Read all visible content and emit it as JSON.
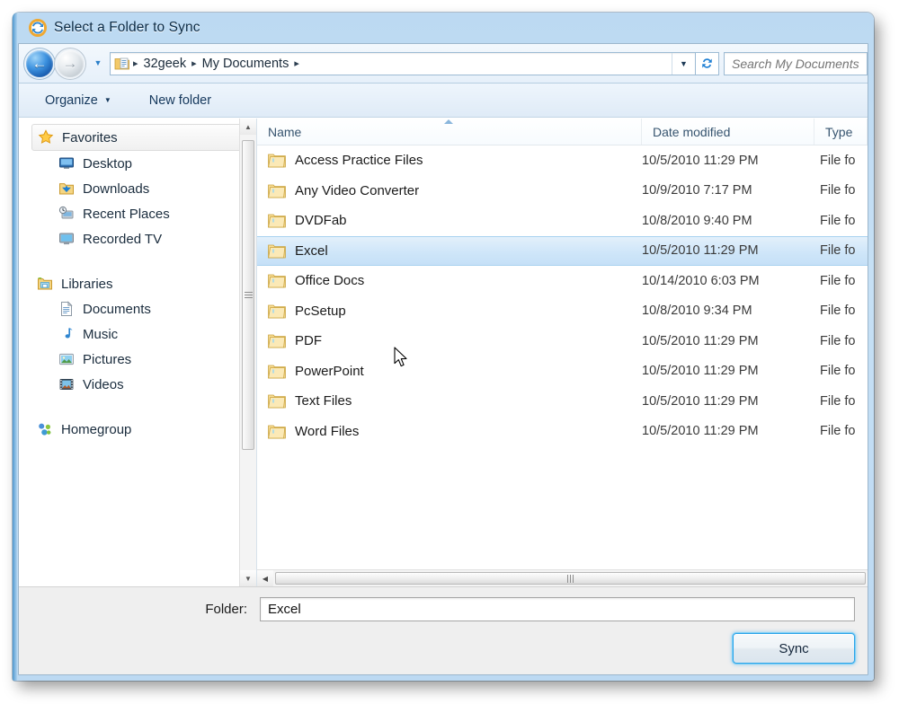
{
  "window": {
    "title": "Select a Folder to Sync",
    "title_icon": "sync-icon"
  },
  "navbar": {
    "back_icon": "back-arrow-icon",
    "forward_icon": "forward-arrow-icon",
    "recent_pages_icon": "chevron-down-icon",
    "address_icon": "folder-documents-icon",
    "breadcrumbs": [
      "32geek",
      "My Documents"
    ],
    "separator": "▸",
    "previous_locations_icon": "chevron-down-icon",
    "refresh_icon": "refresh-icon",
    "refresh_glyph": "↻"
  },
  "search": {
    "placeholder": "Search My Documents"
  },
  "toolbar": {
    "organize_label": "Organize",
    "organize_caret": "▼",
    "new_folder_label": "New folder"
  },
  "navpane": {
    "groups": [
      {
        "header": {
          "label": "Favorites",
          "icon": "star-icon",
          "highlighted": true
        },
        "items": [
          {
            "label": "Desktop",
            "icon": "desktop-icon"
          },
          {
            "label": "Downloads",
            "icon": "downloads-folder-icon"
          },
          {
            "label": "Recent Places",
            "icon": "recent-places-icon"
          },
          {
            "label": "Recorded TV",
            "icon": "recorded-tv-icon"
          }
        ]
      },
      {
        "header": {
          "label": "Libraries",
          "icon": "libraries-icon",
          "highlighted": false
        },
        "items": [
          {
            "label": "Documents",
            "icon": "document-icon"
          },
          {
            "label": "Music",
            "icon": "music-note-icon"
          },
          {
            "label": "Pictures",
            "icon": "picture-icon"
          },
          {
            "label": "Videos",
            "icon": "video-filmstrip-icon"
          }
        ]
      },
      {
        "header": {
          "label": "Homegroup",
          "icon": "homegroup-icon",
          "highlighted": false
        },
        "items": []
      }
    ]
  },
  "filelist": {
    "columns": [
      {
        "key": "name",
        "label": "Name",
        "sorted": "asc"
      },
      {
        "key": "date",
        "label": "Date modified",
        "sorted": ""
      },
      {
        "key": "type",
        "label": "Type",
        "sorted": ""
      }
    ],
    "rows": [
      {
        "name": "Access Practice Files",
        "date": "10/5/2010 11:29 PM",
        "type": "File fo",
        "selected": false
      },
      {
        "name": "Any Video Converter",
        "date": "10/9/2010 7:17 PM",
        "type": "File fo",
        "selected": false
      },
      {
        "name": "DVDFab",
        "date": "10/8/2010 9:40 PM",
        "type": "File fo",
        "selected": false
      },
      {
        "name": "Excel",
        "date": "10/5/2010 11:29 PM",
        "type": "File fo",
        "selected": true
      },
      {
        "name": "Office Docs",
        "date": "10/14/2010 6:03 PM",
        "type": "File fo",
        "selected": false
      },
      {
        "name": "PcSetup",
        "date": "10/8/2010 9:34 PM",
        "type": "File fo",
        "selected": false
      },
      {
        "name": "PDF",
        "date": "10/5/2010 11:29 PM",
        "type": "File fo",
        "selected": false
      },
      {
        "name": "PowerPoint",
        "date": "10/5/2010 11:29 PM",
        "type": "File fo",
        "selected": false
      },
      {
        "name": "Text Files",
        "date": "10/5/2010 11:29 PM",
        "type": "File fo",
        "selected": false
      },
      {
        "name": "Word Files",
        "date": "10/5/2010 11:29 PM",
        "type": "File fo",
        "selected": false
      }
    ]
  },
  "footer": {
    "folder_label": "Folder:",
    "folder_value": "Excel",
    "sync_button_label": "Sync"
  },
  "colors": {
    "accent": "#2aa3e8",
    "selection": "#c5e0f7",
    "frame": "#bcd9f2",
    "folder_yellow": "#f5ce6a"
  }
}
